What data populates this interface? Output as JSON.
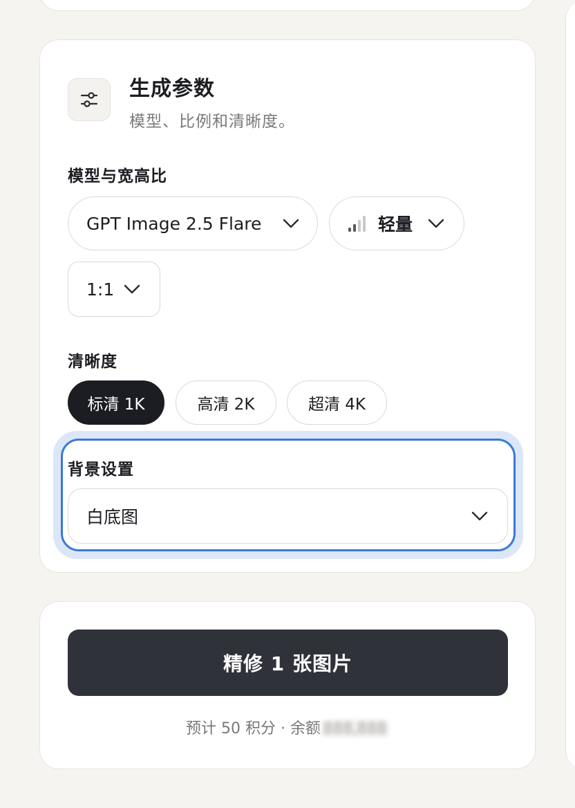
{
  "params": {
    "title": "生成参数",
    "subtitle": "模型、比例和清晰度。",
    "icon": "sliders-icon",
    "model_section_label": "模型与宽高比",
    "model_select": "GPT Image 2.5 Flare",
    "quality_select": "轻量",
    "quality_icon": "signal-bars-icon",
    "ratio_select": "1:1",
    "resolution_label": "清晰度",
    "resolution_options": [
      "标清 1K",
      "高清 2K",
      "超清 4K"
    ],
    "resolution_selected": "标清 1K",
    "background_label": "背景设置",
    "background_select": "白底图"
  },
  "action": {
    "button_label": "精修 1 张图片",
    "cost_text": "预计 50 积分 · 余额",
    "balance_masked": "888,888"
  },
  "colors": {
    "page_bg": "#f5f4f1",
    "primary_button": "#30323a",
    "selected_pill": "#1c1d22",
    "focus_ring": "#3a78d4"
  }
}
